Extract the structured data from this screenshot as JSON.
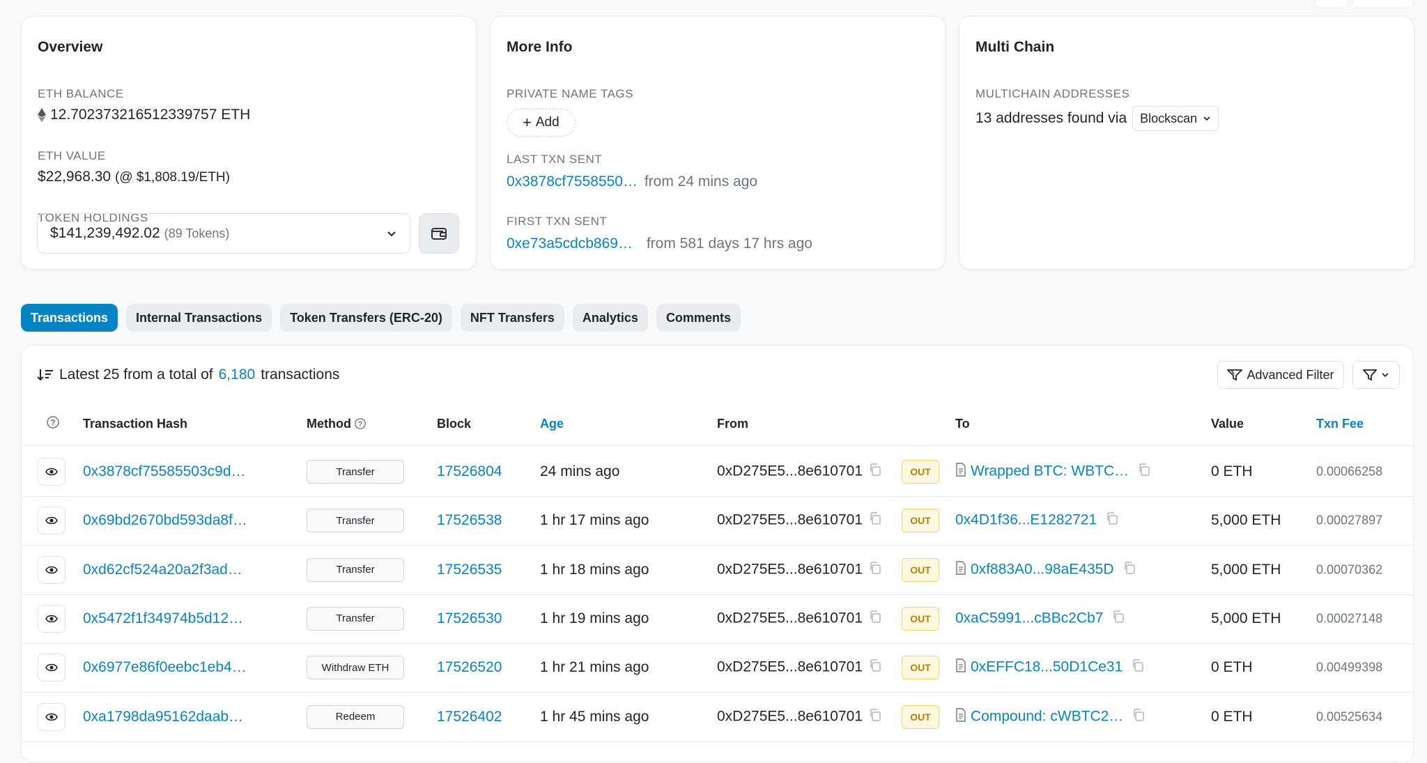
{
  "overview": {
    "title": "Overview",
    "eth_balance_label": "ETH BALANCE",
    "eth_balance": "12.702373216512339757 ETH",
    "eth_value_label": "ETH VALUE",
    "eth_value": "$22,968.30",
    "eth_price": "(@ $1,808.19/ETH)",
    "token_holdings_label": "TOKEN HOLDINGS",
    "token_holdings_value": "$141,239,492.02",
    "token_holdings_count": "(89 Tokens)"
  },
  "more_info": {
    "title": "More Info",
    "private_tags_label": "PRIVATE NAME TAGS",
    "add_label": "Add",
    "last_txn_label": "LAST TXN SENT",
    "last_txn_hash": "0x3878cf7558550…",
    "last_txn_age": "from 24 mins ago",
    "first_txn_label": "FIRST TXN SENT",
    "first_txn_hash": "0xe73a5cdcb869…",
    "first_txn_age": "from 581 days 17 hrs ago"
  },
  "multi_chain": {
    "title": "Multi Chain",
    "addresses_label": "MULTICHAIN ADDRESSES",
    "addresses_text": "13 addresses found via",
    "provider": "Blockscan"
  },
  "tabs": [
    "Transactions",
    "Internal Transactions",
    "Token Transfers (ERC-20)",
    "NFT Transfers",
    "Analytics",
    "Comments"
  ],
  "summary": {
    "prefix": "Latest 25 from a total of",
    "total": "6,180",
    "suffix": "transactions",
    "advanced_filter": "Advanced Filter"
  },
  "columns": {
    "hash": "Transaction Hash",
    "method": "Method",
    "block": "Block",
    "age": "Age",
    "from": "From",
    "to": "To",
    "value": "Value",
    "fee": "Txn Fee"
  },
  "rows": [
    {
      "hash": "0x3878cf75585503c9d…",
      "method": "Transfer",
      "block": "17526804",
      "age": "24 mins ago",
      "from": "0xD275E5...8e610701",
      "dir": "OUT",
      "to": "Wrapped BTC: WBTC…",
      "to_contract": true,
      "value": "0 ETH",
      "fee": "0.00066258"
    },
    {
      "hash": "0x69bd2670bd593da8f…",
      "method": "Transfer",
      "block": "17526538",
      "age": "1 hr 17 mins ago",
      "from": "0xD275E5...8e610701",
      "dir": "OUT",
      "to": "0x4D1f36...E1282721",
      "to_contract": false,
      "value": "5,000 ETH",
      "fee": "0.00027897"
    },
    {
      "hash": "0xd62cf524a20a2f3ad…",
      "method": "Transfer",
      "block": "17526535",
      "age": "1 hr 18 mins ago",
      "from": "0xD275E5...8e610701",
      "dir": "OUT",
      "to": "0xf883A0...98aE435D",
      "to_contract": true,
      "value": "5,000 ETH",
      "fee": "0.00070362"
    },
    {
      "hash": "0x5472f1f34974b5d12…",
      "method": "Transfer",
      "block": "17526530",
      "age": "1 hr 19 mins ago",
      "from": "0xD275E5...8e610701",
      "dir": "OUT",
      "to": "0xaC5991...cBBc2Cb7",
      "to_contract": false,
      "value": "5,000 ETH",
      "fee": "0.00027148"
    },
    {
      "hash": "0x6977e86f0eebc1eb4…",
      "method": "Withdraw ETH",
      "block": "17526520",
      "age": "1 hr 21 mins ago",
      "from": "0xD275E5...8e610701",
      "dir": "OUT",
      "to": "0xEFFC18...50D1Ce31",
      "to_contract": true,
      "value": "0 ETH",
      "fee": "0.00499398"
    },
    {
      "hash": "0xa1798da95162daab…",
      "method": "Redeem",
      "block": "17526402",
      "age": "1 hr 45 mins ago",
      "from": "0xD275E5...8e610701",
      "dir": "OUT",
      "to": "Compound: cWBTC2…",
      "to_contract": true,
      "value": "0 ETH",
      "fee": "0.00525634"
    }
  ]
}
